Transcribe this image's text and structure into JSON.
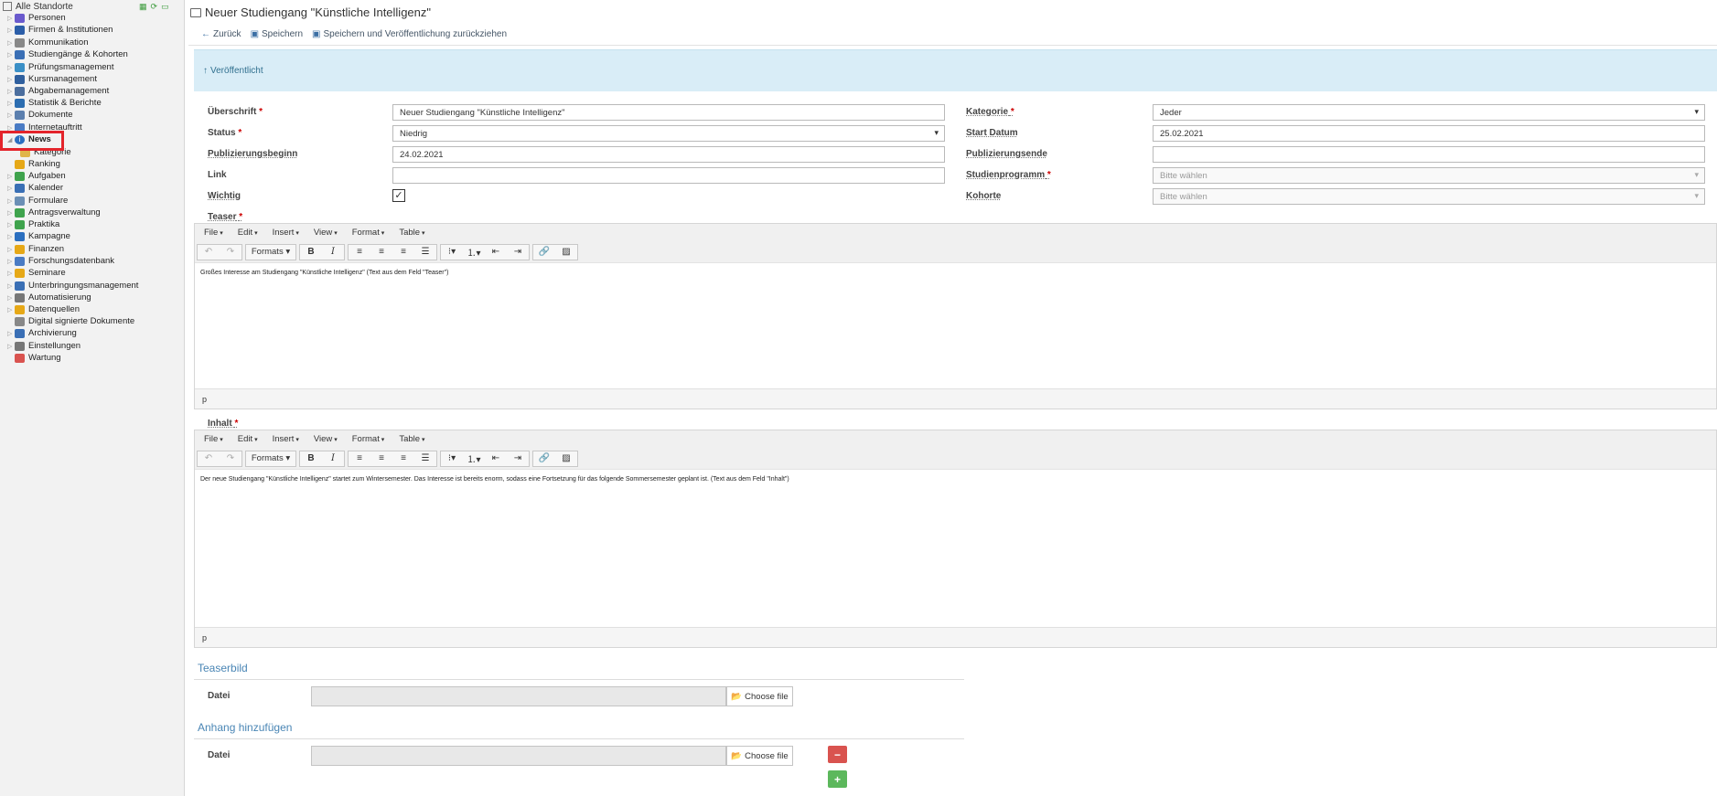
{
  "sidebar": {
    "root_label": "Alle Standorte",
    "items": [
      {
        "label": "Personen",
        "icon": "people-icon",
        "color": "#6a5acd"
      },
      {
        "label": "Firmen & Institutionen",
        "icon": "company-icon",
        "color": "#2b5ea8"
      },
      {
        "label": "Kommunikation",
        "icon": "mail-icon",
        "color": "#888888"
      },
      {
        "label": "Studiengänge & Kohorten",
        "icon": "graduation-icon",
        "color": "#3a6fb5"
      },
      {
        "label": "Prüfungsmanagement",
        "icon": "exam-icon",
        "color": "#3a8fc6"
      },
      {
        "label": "Kursmanagement",
        "icon": "course-icon",
        "color": "#2f5f9e"
      },
      {
        "label": "Abgabemanagement",
        "icon": "submission-icon",
        "color": "#4b6e9e"
      },
      {
        "label": "Statistik & Berichte",
        "icon": "chart-icon",
        "color": "#2c6db0"
      },
      {
        "label": "Dokumente",
        "icon": "documents-icon",
        "color": "#5b7fae"
      },
      {
        "label": "Internetauftritt",
        "icon": "globe-icon",
        "color": "#4a7bc4"
      },
      {
        "label": "News",
        "icon": "info-icon",
        "color": "#2b6fc0"
      },
      {
        "label": "Kategorie",
        "icon": "folder-icon",
        "color": "#e0b54a"
      },
      {
        "label": "Ranking",
        "icon": "ranking-icon",
        "color": "#e6a817"
      },
      {
        "label": "Aufgaben",
        "icon": "tasks-icon",
        "color": "#3fa34d"
      },
      {
        "label": "Kalender",
        "icon": "calendar-icon",
        "color": "#3a6fb5"
      },
      {
        "label": "Formulare",
        "icon": "forms-icon",
        "color": "#6b8fb5"
      },
      {
        "label": "Antragsverwaltung",
        "icon": "applications-icon",
        "color": "#3fa34d"
      },
      {
        "label": "Praktika",
        "icon": "internship-icon",
        "color": "#3fa34d"
      },
      {
        "label": "Kampagne",
        "icon": "campaign-icon",
        "color": "#2b6fc0"
      },
      {
        "label": "Finanzen",
        "icon": "finance-icon",
        "color": "#e6a817"
      },
      {
        "label": "Forschungsdatenbank",
        "icon": "research-icon",
        "color": "#4a7bc4"
      },
      {
        "label": "Seminare",
        "icon": "seminar-icon",
        "color": "#e6a817"
      },
      {
        "label": "Unterbringungsmanagement",
        "icon": "housing-icon",
        "color": "#3a6fb5"
      },
      {
        "label": "Automatisierung",
        "icon": "gear-icon",
        "color": "#777777"
      },
      {
        "label": "Datenquellen",
        "icon": "datasource-icon",
        "color": "#e6a817"
      },
      {
        "label": "Digital signierte Dokumente",
        "icon": "signed-document-icon",
        "color": "#888888"
      },
      {
        "label": "Archivierung",
        "icon": "archive-icon",
        "color": "#3a6fb5"
      },
      {
        "label": "Einstellungen",
        "icon": "settings-icon",
        "color": "#777777"
      },
      {
        "label": "Wartung",
        "icon": "maintenance-icon",
        "color": "#d9534f"
      }
    ]
  },
  "page": {
    "title": "Neuer Studiengang \"Künstliche Intelligenz\"",
    "actions": {
      "back": "Zurück",
      "save": "Speichern",
      "save_unpublish": "Speichern und Veröffentlichung zurückziehen"
    },
    "status_banner": "Veröffentlicht"
  },
  "form": {
    "ueberschrift_label": "Überschrift",
    "ueberschrift_value": "Neuer Studiengang \"Künstliche Intelligenz\"",
    "status_label": "Status",
    "status_value": "Niedrig",
    "pubbeginn_label": "Publizierungsbeginn",
    "pubbeginn_value": "24.02.2021",
    "link_label": "Link",
    "link_value": "",
    "wichtig_label": "Wichtig",
    "wichtig_checked": "✓",
    "kategorie_label": "Kategorie",
    "kategorie_value": "Jeder",
    "startdatum_label": "Start Datum",
    "startdatum_value": "25.02.2021",
    "pubende_label": "Publizierungsende",
    "pubende_value": "",
    "studienprogramm_label": "Studienprogramm",
    "studienprogramm_placeholder": "Bitte wählen",
    "kohorte_label": "Kohorte",
    "kohorte_placeholder": "Bitte wählen",
    "required_mark": "*"
  },
  "editor_menus": [
    "File",
    "Edit",
    "Insert",
    "View",
    "Format",
    "Table"
  ],
  "editor_formats_label": "Formats",
  "teaser": {
    "label": "Teaser",
    "content": "Großes Interesse am Studiengang \"Künstliche Intelligenz\" (Text aus dem Feld \"Teaser\")",
    "path": "p"
  },
  "inhalt": {
    "label": "Inhalt",
    "content": "Der neue Studiengang \"Künstliche Intelligenz\" startet zum Wintersemester. Das Interesse ist bereits enorm, sodass eine Fortsetzung für das folgende Sommersemester geplant ist. (Text aus dem Feld \"Inhalt\")",
    "path": "p"
  },
  "teaserbild": {
    "title": "Teaserbild",
    "datei_label": "Datei",
    "choose_label": "Choose file"
  },
  "anhang": {
    "title": "Anhang hinzufügen",
    "datei_label": "Datei",
    "choose_label": "Choose file",
    "remove_label": "−",
    "add_label": "+"
  }
}
